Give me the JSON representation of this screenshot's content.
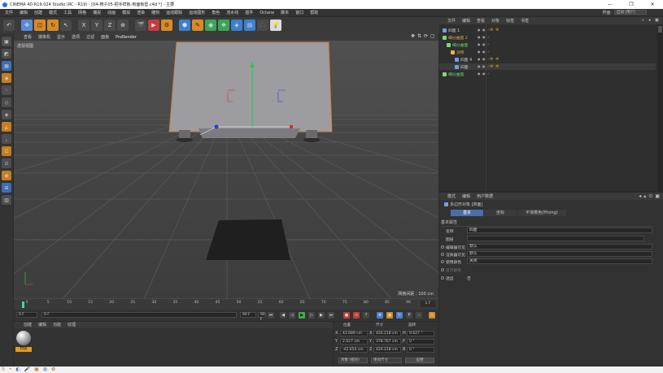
{
  "window": {
    "title": "CINEMA 4D R19.024 Studio (RC - R19) - [04-椅子05-把手样板-到面板型.c4d *] - 主要",
    "buttons": [
      "—",
      "❐",
      "✕"
    ]
  },
  "menu": {
    "items": [
      "文件",
      "编辑",
      "创建",
      "模式",
      "工具",
      "网格",
      "捕捉",
      "动画",
      "模拟",
      "渲染",
      "雕刻",
      "运动跟踪",
      "运动图形",
      "角色",
      "流水线",
      "插件",
      "Octane",
      "脚本",
      "窗口",
      "帮助"
    ],
    "layout_label": "界面:",
    "layout_value": "启动 (用户)"
  },
  "toolbar": {
    "icons": [
      "undo-icon",
      "move-icon",
      "scale-icon",
      "rotate-icon",
      "live-select-icon",
      "x-axis-icon",
      "y-axis-icon",
      "z-axis-icon",
      "world-coord-icon",
      "render-view-icon",
      "render-active-icon",
      "render-settings-icon",
      "cube-icon",
      "pen-icon",
      "subdivision-icon",
      "array-icon",
      "deformer-icon",
      "floor-icon",
      "camera-icon",
      "light-icon"
    ],
    "labels": [
      "↶",
      "✥",
      "◫",
      "↻",
      "↖",
      "X",
      "Y",
      "Z",
      "⊕",
      "🎬",
      "▶",
      "⚙",
      "⬢",
      "✎",
      "◉",
      "❖",
      "◈",
      "▤",
      "🎥",
      "💡"
    ]
  },
  "viewport": {
    "menu": [
      "查看",
      "摄像机",
      "显示",
      "选项",
      "过滤",
      "面板",
      "ProRender"
    ],
    "label": "透视视图",
    "grid_spacing": "网格间距 : 100 cm"
  },
  "timeline": {
    "ticks": [
      "0",
      "5",
      "10",
      "15",
      "20",
      "25",
      "30",
      "35",
      "40",
      "45",
      "50",
      "55",
      "60",
      "65",
      "70",
      "75",
      "80",
      "85",
      "90"
    ],
    "end": "1 F",
    "start_field": "0 F",
    "current_field": "0 F",
    "end_field": "90 F",
    "max_field": "90 F"
  },
  "materials": {
    "tabs": [
      "创建",
      "编辑",
      "功能",
      "纹理"
    ],
    "items": [
      {
        "name": "材质"
      }
    ]
  },
  "coords": {
    "headers": [
      "位置",
      "尺寸",
      "旋转"
    ],
    "rows": [
      {
        "axis": "X",
        "pos": "43.689 cm",
        "size_axis": "X",
        "size": "426.218 cm",
        "rot_axis": "H",
        "rot": "0.627 °"
      },
      {
        "axis": "Y",
        "pos": "2.027 cm",
        "size_axis": "Y",
        "size": "378.767 cm",
        "rot_axis": "P",
        "rot": "0 °"
      },
      {
        "axis": "Z",
        "pos": "-42.654 cm",
        "size_axis": "Z",
        "size": "420.218 cm",
        "rot_axis": "B",
        "rot": "0 °"
      }
    ],
    "mode": "对象 (相对)",
    "size_mode": "绝对尺寸",
    "apply": "应用"
  },
  "object_manager": {
    "tabs": [
      "文件",
      "编辑",
      "查看",
      "对象",
      "标签",
      "书签"
    ],
    "objects": [
      {
        "name": "四面 1",
        "color": "default",
        "indent": 0,
        "icon": "#6da1e3"
      },
      {
        "name": "细分曲面 2",
        "color": "orange",
        "indent": 0,
        "icon": "#7fd77a"
      },
      {
        "name": "细分曲面",
        "color": "green",
        "indent": 1,
        "icon": "#7fd77a"
      },
      {
        "name": "对称",
        "color": "orange",
        "indent": 2,
        "icon": "#e2b150"
      },
      {
        "name": "四面 4",
        "color": "default",
        "indent": 3,
        "icon": "#6da1e3"
      },
      {
        "name": "四面",
        "color": "default",
        "indent": 3,
        "icon": "#6da1e3"
      },
      {
        "name": "细分曲面",
        "color": "green",
        "indent": 0,
        "icon": "#7fd77a"
      }
    ]
  },
  "attributes": {
    "menu": [
      "模式",
      "编辑",
      "用户数据"
    ],
    "object_title": "多边形对象 [四面]",
    "tabs": [
      "基本",
      "坐标",
      "平滑着色(Phong)"
    ],
    "section": "基本属性",
    "fields": [
      {
        "label": "名称",
        "value": "四面"
      },
      {
        "label": "图层",
        "value": ""
      },
      {
        "label": "编辑器可见",
        "value": "默认"
      },
      {
        "label": "渲染器可见",
        "value": "默认"
      },
      {
        "label": "使用颜色",
        "value": "关闭"
      },
      {
        "label": "显示颜色",
        "value": ""
      },
      {
        "label": "透显",
        "value": "否"
      }
    ]
  },
  "colors": {
    "accent": "#5b8ad6",
    "green": "#71d86d",
    "orange": "#e8a54c"
  }
}
